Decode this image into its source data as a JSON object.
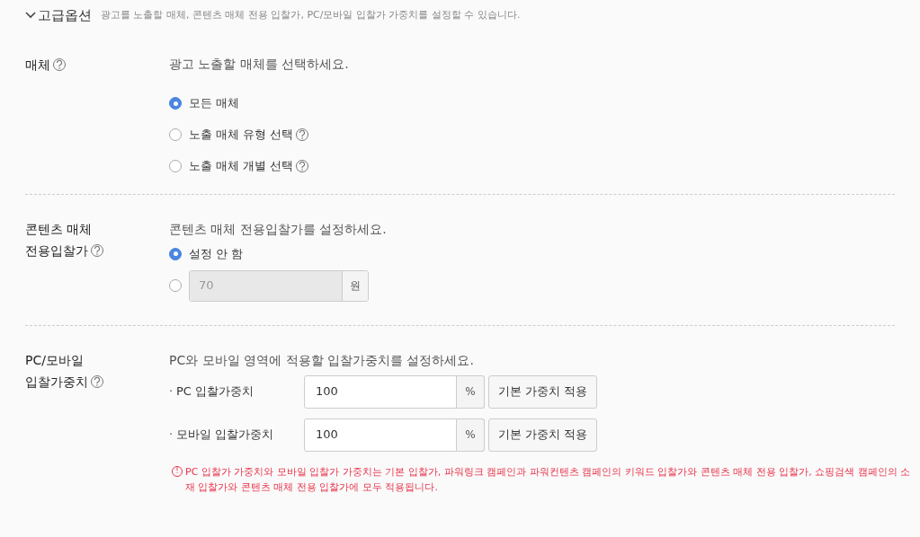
{
  "header": {
    "title": "고급옵션",
    "expanded": true,
    "description": "광고를 노출할 매체, 콘텐츠 매체 전용 입찰가, PC/모바일 입찰가 가중치를 설정할 수 있습니다."
  },
  "sections": [
    {
      "kind": "radios",
      "label": [
        "매체"
      ],
      "instruction": "광고 노출할 매체를 선택하세요.",
      "options": [
        {
          "label": "모든 매체",
          "selected": true,
          "help": false
        },
        {
          "label": "노출 매체 유형 선택",
          "selected": false,
          "help": true
        },
        {
          "label": "노출 매체 개별 선택",
          "selected": false,
          "help": true
        }
      ]
    },
    {
      "kind": "bid",
      "label": [
        "콘텐츠 매체",
        "전용입찰가"
      ],
      "instruction": "콘텐츠 매체 전용입찰가를 설정하세요.",
      "options": [
        {
          "label": "설정 안 함",
          "selected": true
        },
        {
          "value": "70",
          "unit": "원",
          "disabled": true,
          "selected": false
        }
      ]
    },
    {
      "kind": "weights",
      "label": [
        "PC/모바일",
        "입찰가중치"
      ],
      "instruction": "PC와 모바일 영역에 적용할 입찰가중치를 설정하세요.",
      "rows": [
        {
          "bullet": "·",
          "label": "PC 입찰가중치",
          "value": "100",
          "unit": "%",
          "button": "기본 가중치 적용"
        },
        {
          "bullet": "·",
          "label": "모바일 입찰가중치",
          "value": "100",
          "unit": "%",
          "button": "기본 가중치 적용"
        }
      ],
      "note": {
        "icon": "!",
        "text": "PC 입찰가 가중치와 모바일 입찰가 가중치는 기본 입찰가, 파워링크 캠페인과 파워컨텐츠 캠페인의 키워드 입찰가와 콘텐츠 매체 전용 입찰가, 쇼핑검색 캠페인의 소재 입찰가와 콘텐츠 매체 전용 입찰가에 모두 적용됩니다."
      }
    }
  ]
}
